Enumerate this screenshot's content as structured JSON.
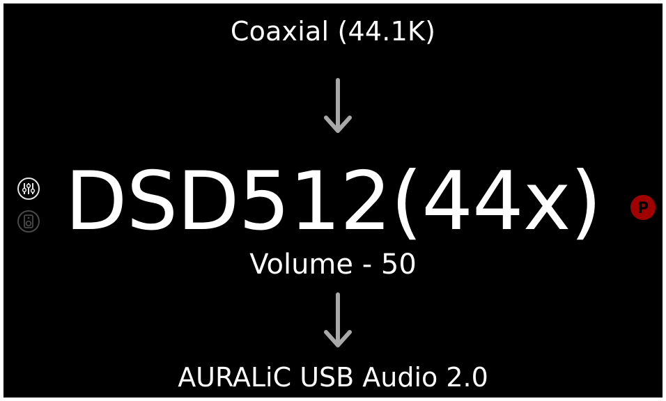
{
  "display": {
    "input": "Coaxial (44.1K)",
    "format": "DSD512(44x)",
    "volume": "Volume - 50",
    "output": "AURALiC USB Audio 2.0"
  },
  "icons": {
    "flow_arrows": "arrow-down",
    "left_controls": [
      "equalizer-icon",
      "speaker-icon"
    ],
    "right_badge": "p-badge-icon"
  },
  "colors": {
    "background": "#000000",
    "text": "#ffffff",
    "arrow": "#a8a8a8",
    "p_badge": "#a00000"
  }
}
